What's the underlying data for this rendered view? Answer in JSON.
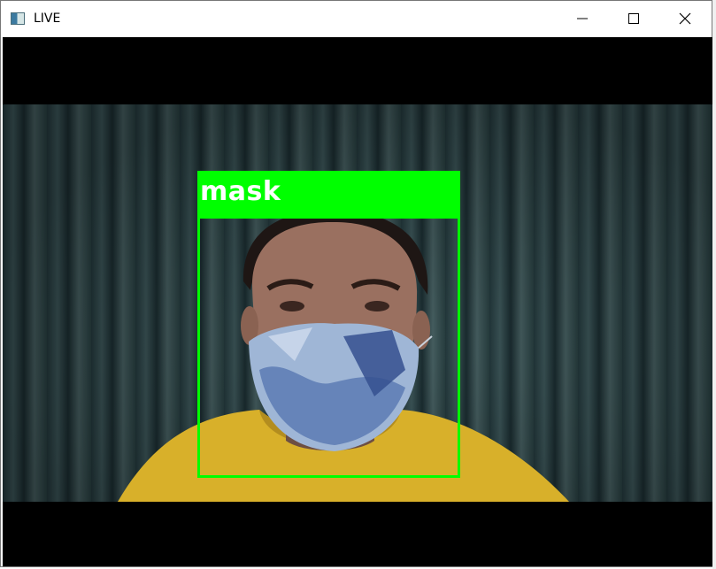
{
  "window": {
    "title": "LIVE",
    "icons": {
      "app": "opencv-window-icon",
      "minimize": "minimize-icon",
      "maximize": "maximize-icon",
      "close": "close-icon"
    }
  },
  "detection": {
    "label": "mask",
    "box_color": "#00ff00",
    "label_text_color": "#ffffff"
  },
  "colors": {
    "letterbox": "#000000",
    "background": "#2f4548",
    "shirt": "#d8b02a",
    "skin": "#9a7060",
    "mask": "#9fb6d6"
  }
}
